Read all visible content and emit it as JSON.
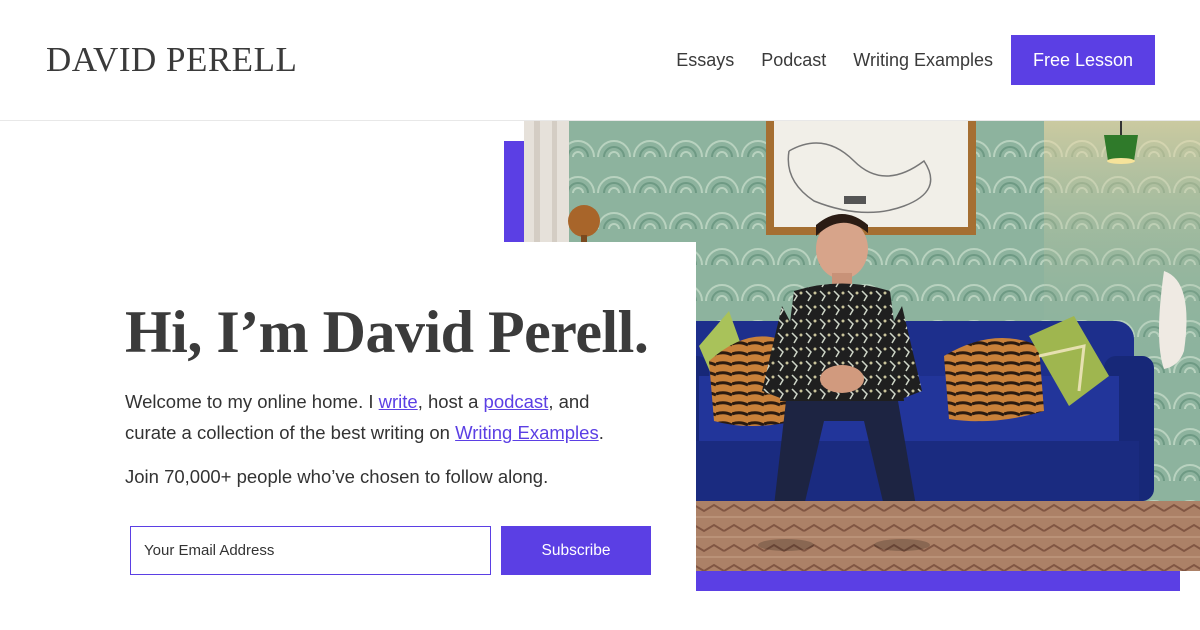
{
  "header": {
    "logo": "DAVID PERELL",
    "nav": [
      {
        "label": "Essays"
      },
      {
        "label": "Podcast"
      },
      {
        "label": "Writing Examples"
      }
    ],
    "cta_label": "Free Lesson"
  },
  "hero": {
    "headline": "Hi, I’m David Perell.",
    "intro": {
      "part1": "Welcome to my online home. I ",
      "link_write": "write",
      "part2": ", host a ",
      "link_podcast": "podcast",
      "part3": ", and curate a collection of the best writing on ",
      "link_examples": "Writing Examples",
      "part4": "."
    },
    "join_text": "Join 70,000+ people who’ve chosen to follow along.",
    "email_placeholder": "Your Email Address",
    "subscribe_label": "Subscribe"
  },
  "colors": {
    "accent": "#5b3fe4",
    "wall": "#8fb5a0",
    "sofa": "#1c2f8a"
  }
}
